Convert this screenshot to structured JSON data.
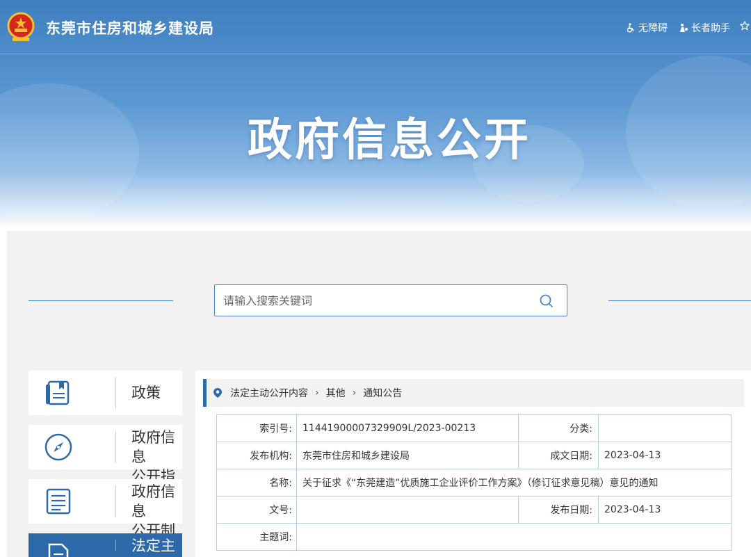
{
  "header": {
    "site_title": "东莞市住房和城乡建设局",
    "tools": {
      "accessibility": "无障碍",
      "elder_helper": "长者助手"
    },
    "banner_title": "政府信息公开"
  },
  "search": {
    "placeholder": "请输入搜索关键词",
    "value": ""
  },
  "sidebar": {
    "items": [
      {
        "label": "政策",
        "icon": "policy-book-icon"
      },
      {
        "label": "政府信息\n公开指南",
        "icon": "compass-icon"
      },
      {
        "label": "政府信息\n公开制度",
        "icon": "document-list-icon"
      },
      {
        "label": "法定主动",
        "icon": "file-icon"
      }
    ]
  },
  "breadcrumb": {
    "items": [
      "法定主动公开内容",
      "其他",
      "通知公告"
    ]
  },
  "meta": {
    "index_no_label": "索引号:",
    "index_no": "11441900007329909L/2023-00213",
    "category_label": "分类:",
    "category": "",
    "publisher_label": "发布机构:",
    "publisher": "东莞市住房和城乡建设局",
    "created_date_label": "成文日期:",
    "created_date": "2023-04-13",
    "name_label": "名称:",
    "name": "关于征求《“东莞建造”优质施工企业评价工作方案》（修订征求意见稿）意见的通知",
    "doc_no_label": "文号:",
    "doc_no": "",
    "publish_date_label": "发布日期:",
    "publish_date": "2023-04-13",
    "subject_label": "主题词:",
    "subject": ""
  },
  "colors": {
    "primary": "#2c69a8",
    "banner": "#4f8ccb",
    "border": "#b7cde3",
    "background": "#f2f2f2"
  }
}
